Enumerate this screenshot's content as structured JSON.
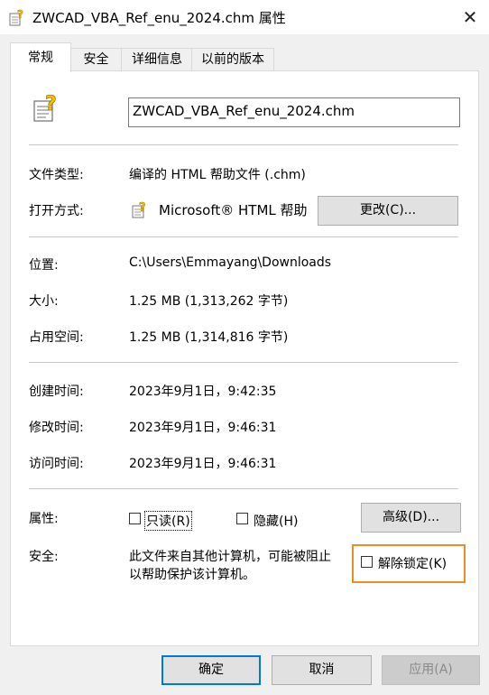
{
  "window": {
    "title": "ZWCAD_VBA_Ref_enu_2024.chm 属性",
    "close_glyph": "✕"
  },
  "tabs": [
    {
      "label": "常规",
      "active": true
    },
    {
      "label": "安全",
      "active": false
    },
    {
      "label": "详细信息",
      "active": false
    },
    {
      "label": "以前的版本",
      "active": false
    }
  ],
  "general": {
    "file_icon": "chm-file-icon",
    "filename": "ZWCAD_VBA_Ref_enu_2024.chm",
    "file_type_label": "文件类型:",
    "file_type_value": "编译的 HTML 帮助文件 (.chm)",
    "open_with_label": "打开方式:",
    "open_with_icon": "help-viewer-icon",
    "open_with_value": "Microsoft® HTML 帮助",
    "change_button": "更改(C)...",
    "location_label": "位置:",
    "location_value": "C:\\Users\\Emmayang\\Downloads",
    "size_label": "大小:",
    "size_value": "1.25 MB (1,313,262 字节)",
    "size_on_disk_label": "占用空间:",
    "size_on_disk_value": "1.25 MB (1,314,816 字节)",
    "created_label": "创建时间:",
    "created_value": "2023年9月1日，9:42:35",
    "modified_label": "修改时间:",
    "modified_value": "2023年9月1日，9:46:31",
    "accessed_label": "访问时间:",
    "accessed_value": "2023年9月1日，9:46:31",
    "attributes_label": "属性:",
    "readonly_label": "只读(R)",
    "readonly_checked": false,
    "hidden_label": "隐藏(H)",
    "hidden_checked": false,
    "advanced_button": "高级(D)...",
    "security_label": "安全:",
    "security_text_line1": "此文件来自其他计算机，可能被阻止",
    "security_text_line2": "以帮助保护该计算机。",
    "unblock_label": "解除锁定(K)",
    "unblock_checked": false
  },
  "footer": {
    "ok": "确定",
    "cancel": "取消",
    "apply": "应用(A)"
  },
  "colors": {
    "accent": "#0078d7",
    "highlight_frame": "#f08c1e",
    "icon_yellow": "#f5c400"
  }
}
